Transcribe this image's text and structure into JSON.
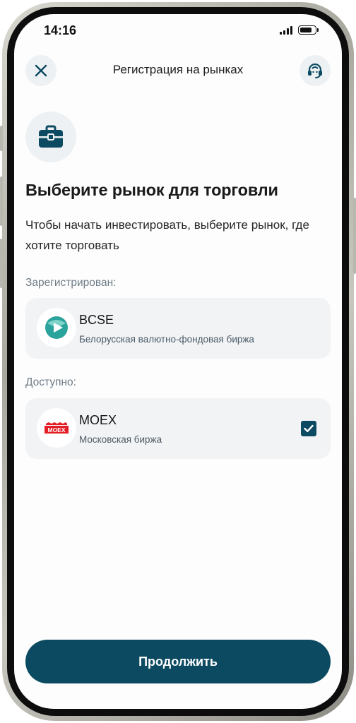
{
  "status_bar": {
    "time": "14:16"
  },
  "header": {
    "title": "Регистрация на рынках"
  },
  "page": {
    "title": "Выберите рынок для торговли",
    "description": "Чтобы начать инвестировать, выберите рынок, где хотите торговать"
  },
  "sections": {
    "registered_label": "Зарегистрирован:",
    "available_label": "Доступно:"
  },
  "markets": {
    "registered": [
      {
        "name": "BCSE",
        "subtitle": "Белорусская валютно-фондовая биржа",
        "icon": "bcse-logo"
      }
    ],
    "available": [
      {
        "name": "MOEX",
        "subtitle": "Московская биржа",
        "icon": "moex-logo",
        "logo_text": "MOEX",
        "selected": true
      }
    ]
  },
  "footer": {
    "continue_label": "Продолжить"
  },
  "colors": {
    "accent": "#0c4a62",
    "card_bg": "#f1f3f5",
    "icon_circle_bg": "#eef1f3",
    "moex_red": "#e31e24",
    "bcse_teal": "#2aa39c"
  }
}
